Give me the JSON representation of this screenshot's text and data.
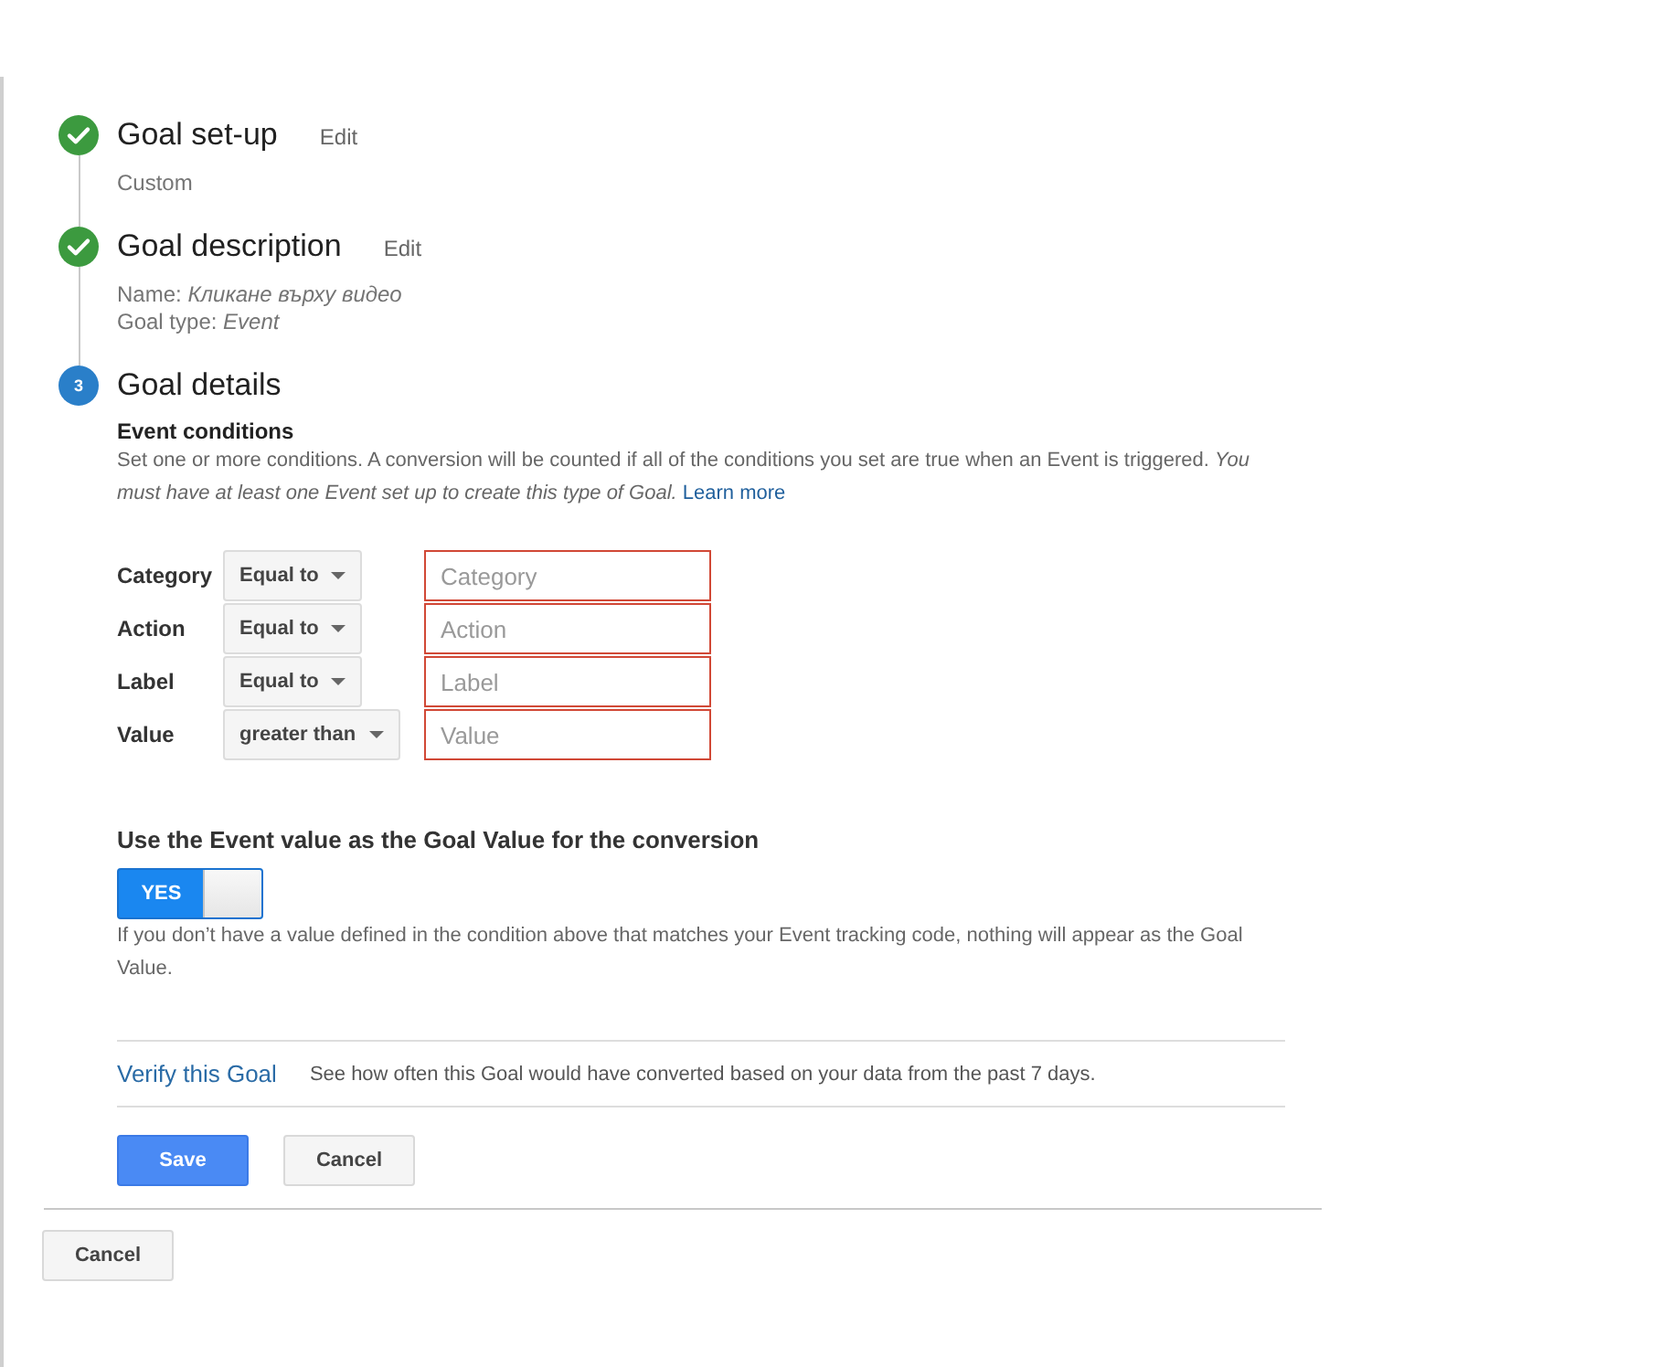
{
  "steps": [
    {
      "kind": "done",
      "title": "Goal set-up",
      "edit": "Edit",
      "details": [
        "Custom"
      ]
    },
    {
      "kind": "done",
      "title": "Goal description",
      "edit": "Edit",
      "details": [
        "Name: *Кликане върху видео*",
        "Goal type: *Event*"
      ]
    },
    {
      "kind": "current",
      "number": "3",
      "title": "Goal details",
      "event_conditions": {
        "title": "Event conditions",
        "description": "Set one or more conditions. A conversion will be counted if all of the conditions you set are true when an Event is triggered. *You must have at least one Event set up to create this type of Goal.*",
        "link": "Learn more",
        "conditions": [
          {
            "label": "Category",
            "operator": "Equal to",
            "placeholder": "Category",
            "invalid": true
          },
          {
            "label": "Action",
            "operator": "Equal to",
            "placeholder": "Action",
            "invalid": true
          },
          {
            "label": "Label",
            "operator": "Equal to",
            "placeholder": "Label",
            "invalid": true
          },
          {
            "label": "Value",
            "operator": "greater than",
            "placeholder": "Value",
            "invalid": true
          }
        ]
      },
      "value_toggle": {
        "label": "Use the Event value as the Goal Value for the conversion",
        "on": true,
        "on_text": "YES",
        "hint": "If you don’t have a value defined in the condition above that matches your Event tracking code, nothing will appear as the Goal Value."
      },
      "verify": {
        "link": "Verify this Goal",
        "text": "See how often this Goal would have converted based on your data from the past 7 days."
      },
      "buttons": [
        {
          "kind": "primary",
          "label": "Save"
        },
        {
          "kind": "secondary",
          "label": "Cancel"
        }
      ]
    }
  ],
  "cancel_button": "Cancel"
}
